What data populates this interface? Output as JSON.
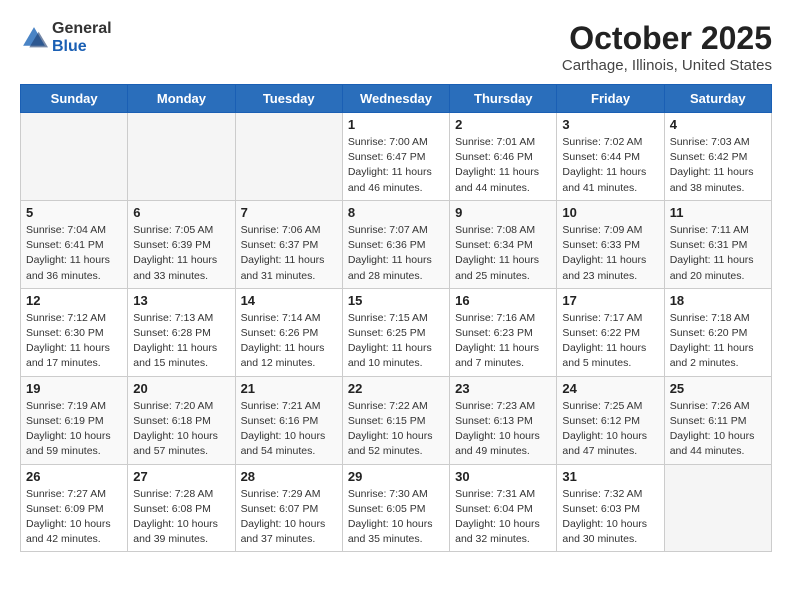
{
  "header": {
    "logo_general": "General",
    "logo_blue": "Blue",
    "month": "October 2025",
    "location": "Carthage, Illinois, United States"
  },
  "weekdays": [
    "Sunday",
    "Monday",
    "Tuesday",
    "Wednesday",
    "Thursday",
    "Friday",
    "Saturday"
  ],
  "weeks": [
    [
      {
        "day": "",
        "info": ""
      },
      {
        "day": "",
        "info": ""
      },
      {
        "day": "",
        "info": ""
      },
      {
        "day": "1",
        "info": "Sunrise: 7:00 AM\nSunset: 6:47 PM\nDaylight: 11 hours\nand 46 minutes."
      },
      {
        "day": "2",
        "info": "Sunrise: 7:01 AM\nSunset: 6:46 PM\nDaylight: 11 hours\nand 44 minutes."
      },
      {
        "day": "3",
        "info": "Sunrise: 7:02 AM\nSunset: 6:44 PM\nDaylight: 11 hours\nand 41 minutes."
      },
      {
        "day": "4",
        "info": "Sunrise: 7:03 AM\nSunset: 6:42 PM\nDaylight: 11 hours\nand 38 minutes."
      }
    ],
    [
      {
        "day": "5",
        "info": "Sunrise: 7:04 AM\nSunset: 6:41 PM\nDaylight: 11 hours\nand 36 minutes."
      },
      {
        "day": "6",
        "info": "Sunrise: 7:05 AM\nSunset: 6:39 PM\nDaylight: 11 hours\nand 33 minutes."
      },
      {
        "day": "7",
        "info": "Sunrise: 7:06 AM\nSunset: 6:37 PM\nDaylight: 11 hours\nand 31 minutes."
      },
      {
        "day": "8",
        "info": "Sunrise: 7:07 AM\nSunset: 6:36 PM\nDaylight: 11 hours\nand 28 minutes."
      },
      {
        "day": "9",
        "info": "Sunrise: 7:08 AM\nSunset: 6:34 PM\nDaylight: 11 hours\nand 25 minutes."
      },
      {
        "day": "10",
        "info": "Sunrise: 7:09 AM\nSunset: 6:33 PM\nDaylight: 11 hours\nand 23 minutes."
      },
      {
        "day": "11",
        "info": "Sunrise: 7:11 AM\nSunset: 6:31 PM\nDaylight: 11 hours\nand 20 minutes."
      }
    ],
    [
      {
        "day": "12",
        "info": "Sunrise: 7:12 AM\nSunset: 6:30 PM\nDaylight: 11 hours\nand 17 minutes."
      },
      {
        "day": "13",
        "info": "Sunrise: 7:13 AM\nSunset: 6:28 PM\nDaylight: 11 hours\nand 15 minutes."
      },
      {
        "day": "14",
        "info": "Sunrise: 7:14 AM\nSunset: 6:26 PM\nDaylight: 11 hours\nand 12 minutes."
      },
      {
        "day": "15",
        "info": "Sunrise: 7:15 AM\nSunset: 6:25 PM\nDaylight: 11 hours\nand 10 minutes."
      },
      {
        "day": "16",
        "info": "Sunrise: 7:16 AM\nSunset: 6:23 PM\nDaylight: 11 hours\nand 7 minutes."
      },
      {
        "day": "17",
        "info": "Sunrise: 7:17 AM\nSunset: 6:22 PM\nDaylight: 11 hours\nand 5 minutes."
      },
      {
        "day": "18",
        "info": "Sunrise: 7:18 AM\nSunset: 6:20 PM\nDaylight: 11 hours\nand 2 minutes."
      }
    ],
    [
      {
        "day": "19",
        "info": "Sunrise: 7:19 AM\nSunset: 6:19 PM\nDaylight: 10 hours\nand 59 minutes."
      },
      {
        "day": "20",
        "info": "Sunrise: 7:20 AM\nSunset: 6:18 PM\nDaylight: 10 hours\nand 57 minutes."
      },
      {
        "day": "21",
        "info": "Sunrise: 7:21 AM\nSunset: 6:16 PM\nDaylight: 10 hours\nand 54 minutes."
      },
      {
        "day": "22",
        "info": "Sunrise: 7:22 AM\nSunset: 6:15 PM\nDaylight: 10 hours\nand 52 minutes."
      },
      {
        "day": "23",
        "info": "Sunrise: 7:23 AM\nSunset: 6:13 PM\nDaylight: 10 hours\nand 49 minutes."
      },
      {
        "day": "24",
        "info": "Sunrise: 7:25 AM\nSunset: 6:12 PM\nDaylight: 10 hours\nand 47 minutes."
      },
      {
        "day": "25",
        "info": "Sunrise: 7:26 AM\nSunset: 6:11 PM\nDaylight: 10 hours\nand 44 minutes."
      }
    ],
    [
      {
        "day": "26",
        "info": "Sunrise: 7:27 AM\nSunset: 6:09 PM\nDaylight: 10 hours\nand 42 minutes."
      },
      {
        "day": "27",
        "info": "Sunrise: 7:28 AM\nSunset: 6:08 PM\nDaylight: 10 hours\nand 39 minutes."
      },
      {
        "day": "28",
        "info": "Sunrise: 7:29 AM\nSunset: 6:07 PM\nDaylight: 10 hours\nand 37 minutes."
      },
      {
        "day": "29",
        "info": "Sunrise: 7:30 AM\nSunset: 6:05 PM\nDaylight: 10 hours\nand 35 minutes."
      },
      {
        "day": "30",
        "info": "Sunrise: 7:31 AM\nSunset: 6:04 PM\nDaylight: 10 hours\nand 32 minutes."
      },
      {
        "day": "31",
        "info": "Sunrise: 7:32 AM\nSunset: 6:03 PM\nDaylight: 10 hours\nand 30 minutes."
      },
      {
        "day": "",
        "info": ""
      }
    ]
  ]
}
